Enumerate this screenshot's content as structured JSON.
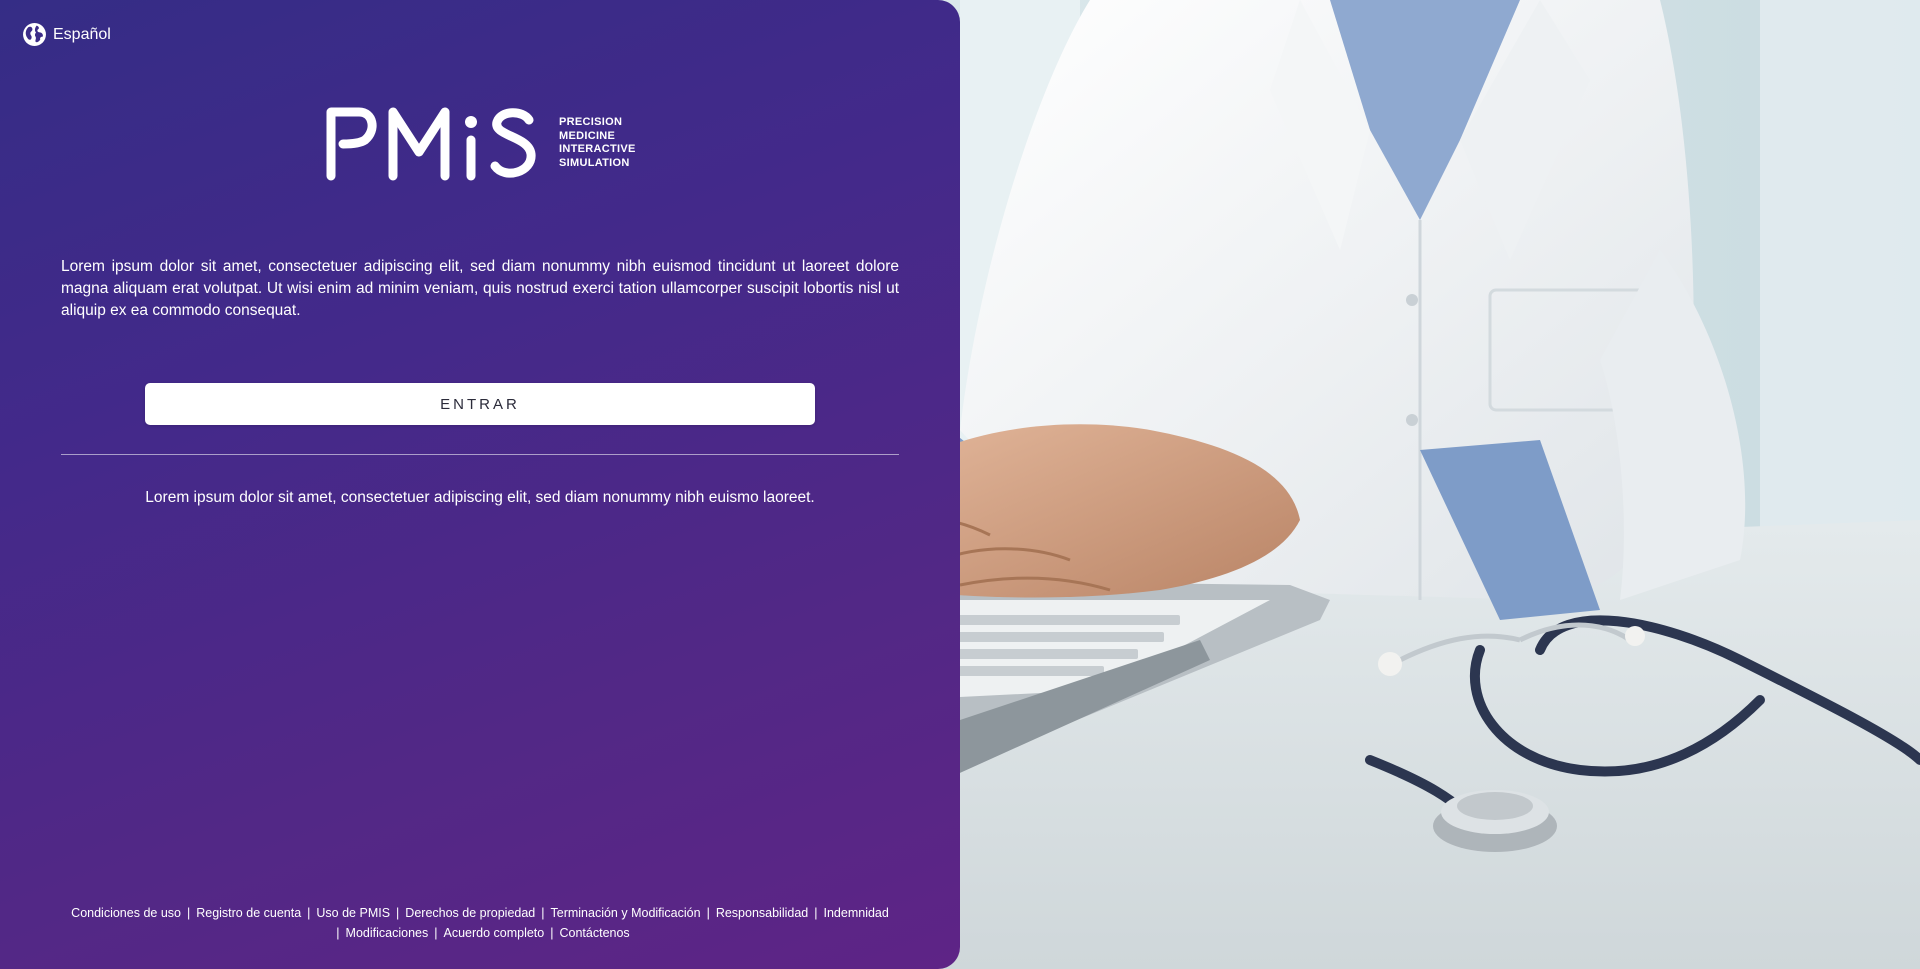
{
  "language": {
    "label": "Español",
    "icon": "globe-icon"
  },
  "logo": {
    "wordmark": "PMiS",
    "tagline": [
      "PRECISION",
      "MEDICINE",
      "INTERACTIVE",
      "SIMULATION"
    ]
  },
  "intro_text": "Lorem ipsum dolor sit amet, consectetuer adipiscing elit, sed diam nonummy nibh euismod tincidunt ut laoreet dolore magna aliquam erat volutpat. Ut wisi enim ad minim veniam, quis nostrud exerci tation ullamcorper suscipit lobortis nisl ut aliquip ex ea commodo consequat.",
  "enter_button": {
    "label": "ENTRAR"
  },
  "sub_text": "Lorem ipsum dolor sit amet, consectetuer adipiscing elit, sed diam nonummy nibh euismo laoreet.",
  "footer_links": [
    "Condiciones de uso",
    "Registro de cuenta",
    "Uso de PMIS",
    "Derechos de propiedad",
    "Terminación y Modificación",
    "Responsabilidad",
    "Indemnidad",
    "Modificaciones",
    "Acuerdo completo",
    "Contáctenos"
  ],
  "footer_separator": "|",
  "colors": {
    "panel_gradient_start": "#352d86",
    "panel_gradient_end": "#5e2486",
    "button_background": "#ffffff",
    "text": "#ffffff"
  },
  "hero_image": {
    "subject": "doctor typing on laptop with stethoscope"
  }
}
